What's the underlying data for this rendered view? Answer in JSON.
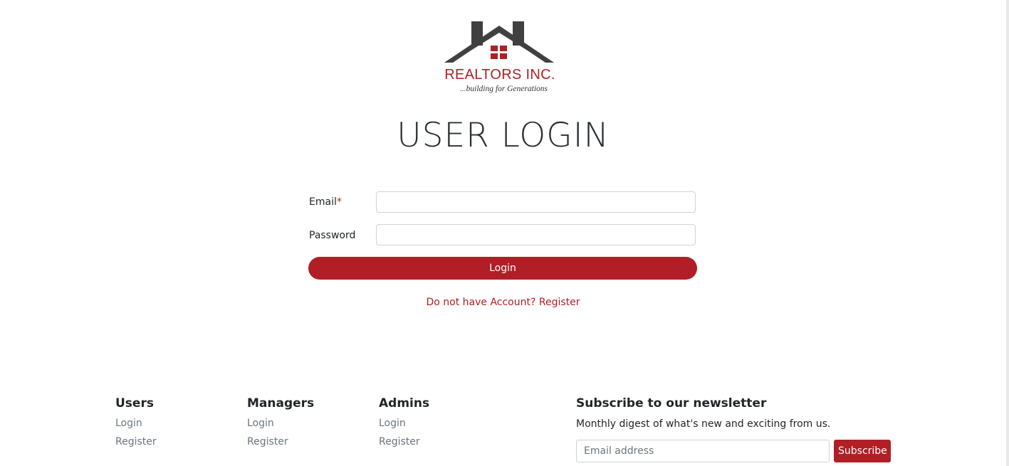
{
  "logo": {
    "name": "REALTORS INC.",
    "tagline": "...building for Generations"
  },
  "page_title": "USER LOGIN",
  "form": {
    "email_label": "Email",
    "email_required_mark": "*",
    "email_value": "",
    "password_label": "Password",
    "password_value": "",
    "login_button": "Login",
    "register_link": "Do not have Account? Register"
  },
  "footer": {
    "columns": [
      {
        "heading": "Users",
        "links": [
          "Login",
          "Register"
        ]
      },
      {
        "heading": "Managers",
        "links": [
          "Login",
          "Register"
        ]
      },
      {
        "heading": "Admins",
        "links": [
          "Login",
          "Register"
        ]
      }
    ],
    "newsletter": {
      "heading": "Subscribe to our newsletter",
      "description": "Monthly digest of what's new and exciting from us.",
      "email_placeholder": "Email address",
      "subscribe_button": "Subscribe"
    }
  },
  "colors": {
    "brand": "#b01f25",
    "logo_gray": "#404040"
  }
}
